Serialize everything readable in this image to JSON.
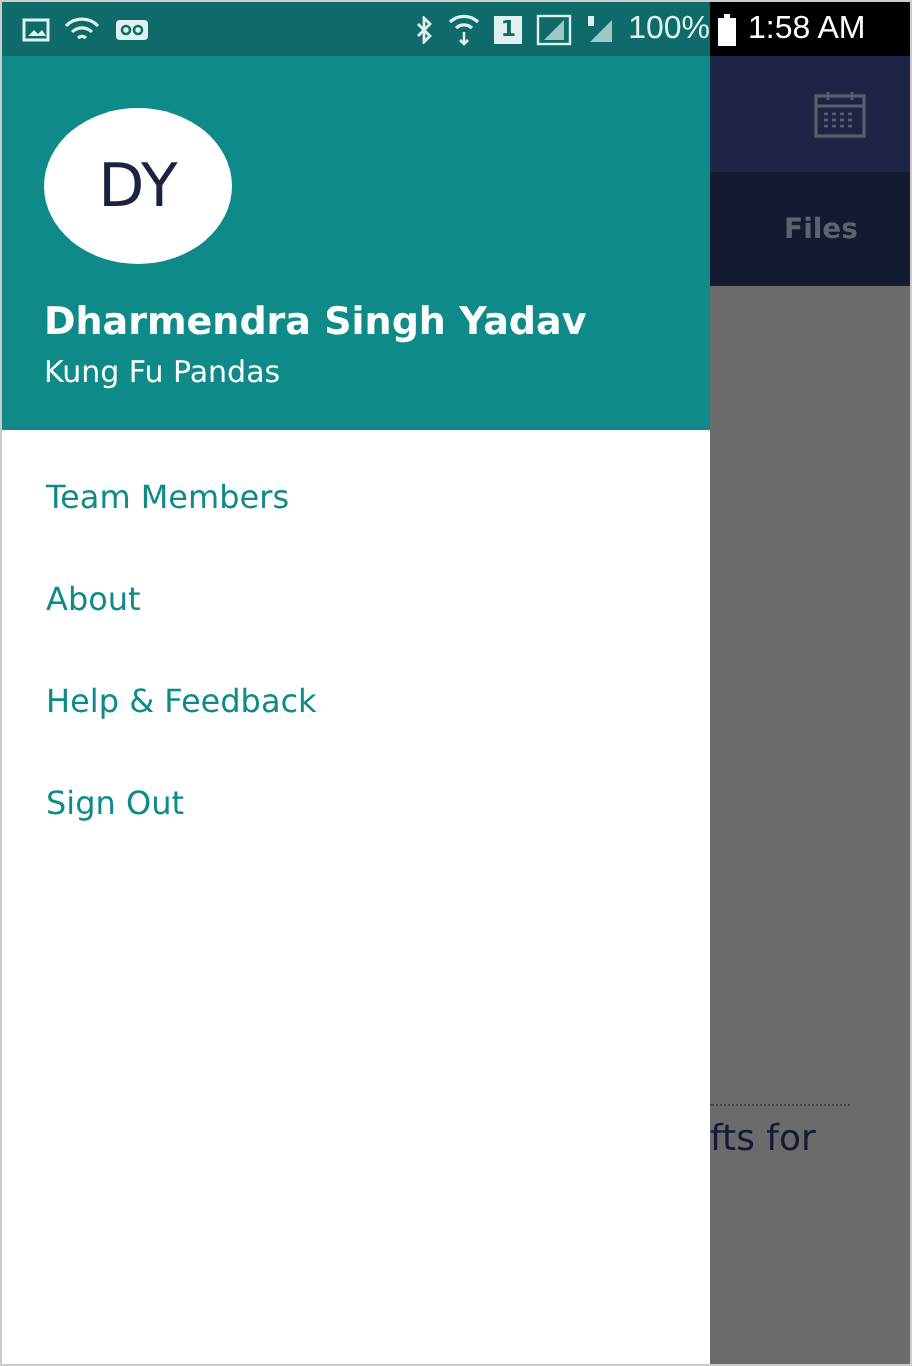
{
  "status_bar": {
    "sim_slot": "1",
    "battery": "100%",
    "time": "1:58 AM"
  },
  "drawer": {
    "avatar_initials": "DY",
    "user_name": "Dharmendra Singh Yadav",
    "team": "Kung Fu Pandas",
    "items": [
      {
        "label": "Team Members"
      },
      {
        "label": "About"
      },
      {
        "label": "Help & Feedback"
      },
      {
        "label": "Sign Out"
      }
    ]
  },
  "background": {
    "tab": "Files",
    "text_fragment": "fts for"
  }
}
